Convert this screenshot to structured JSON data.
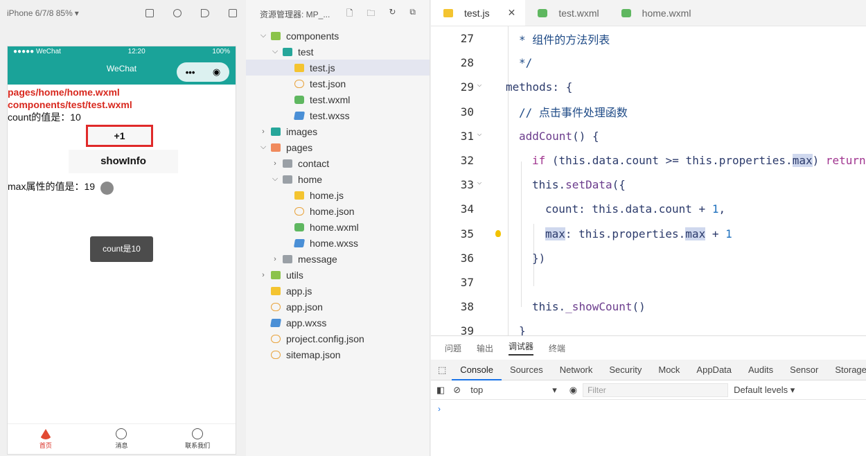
{
  "simulator": {
    "device": "iPhone 6/7/8 85%",
    "carrier": "●●●●● WeChat",
    "time": "12:20",
    "battery": "100%",
    "nav_title": "WeChat",
    "lines": {
      "home_path": "pages/home/home.wxml",
      "test_path": "components/test/test.wxml",
      "count_text": "count的值是：10",
      "add_button": "+1",
      "showinfo_button": "showInfo",
      "max_text": "max属性的值是：19"
    },
    "toast": "count是10",
    "tabbar": [
      {
        "label": "首页",
        "icon": "home-icon"
      },
      {
        "label": "消息",
        "icon": "chat-icon"
      },
      {
        "label": "联系我们",
        "icon": "phone-icon"
      }
    ]
  },
  "explorer": {
    "title": "资源管理器: MP_...",
    "tree": [
      {
        "label": "components",
        "depth": 0,
        "chev": "v",
        "icon": "fold-g"
      },
      {
        "label": "test",
        "depth": 1,
        "chev": "v",
        "icon": "fold-t"
      },
      {
        "label": "test.js",
        "depth": 2,
        "chev": "",
        "icon": "js",
        "selected": true
      },
      {
        "label": "test.json",
        "depth": 2,
        "chev": "",
        "icon": "json"
      },
      {
        "label": "test.wxml",
        "depth": 2,
        "chev": "",
        "icon": "wxml"
      },
      {
        "label": "test.wxss",
        "depth": 2,
        "chev": "",
        "icon": "wxss"
      },
      {
        "label": "images",
        "depth": 0,
        "chev": ">",
        "icon": "fold-t"
      },
      {
        "label": "pages",
        "depth": 0,
        "chev": "v",
        "icon": "fold-o"
      },
      {
        "label": "contact",
        "depth": 1,
        "chev": ">",
        "icon": "folder"
      },
      {
        "label": "home",
        "depth": 1,
        "chev": "v",
        "icon": "folder"
      },
      {
        "label": "home.js",
        "depth": 2,
        "chev": "",
        "icon": "js"
      },
      {
        "label": "home.json",
        "depth": 2,
        "chev": "",
        "icon": "json"
      },
      {
        "label": "home.wxml",
        "depth": 2,
        "chev": "",
        "icon": "wxml"
      },
      {
        "label": "home.wxss",
        "depth": 2,
        "chev": "",
        "icon": "wxss"
      },
      {
        "label": "message",
        "depth": 1,
        "chev": ">",
        "icon": "folder"
      },
      {
        "label": "utils",
        "depth": 0,
        "chev": ">",
        "icon": "fold-g"
      },
      {
        "label": "app.js",
        "depth": 0,
        "chev": "",
        "icon": "js"
      },
      {
        "label": "app.json",
        "depth": 0,
        "chev": "",
        "icon": "json"
      },
      {
        "label": "app.wxss",
        "depth": 0,
        "chev": "",
        "icon": "wxss"
      },
      {
        "label": "project.config.json",
        "depth": 0,
        "chev": "",
        "icon": "json"
      },
      {
        "label": "sitemap.json",
        "depth": 0,
        "chev": "",
        "icon": "json"
      }
    ]
  },
  "editor": {
    "tabs": [
      {
        "label": "test.js",
        "active": true
      },
      {
        "label": "test.wxml",
        "active": false
      },
      {
        "label": "home.wxml",
        "active": false
      }
    ],
    "lines": [
      {
        "n": "27",
        "fold": false,
        "segs": [
          [
            "cm",
            "* 组件的方法列表"
          ]
        ]
      },
      {
        "n": "28",
        "fold": false,
        "segs": [
          [
            "cm",
            "*/"
          ]
        ]
      },
      {
        "n": "29",
        "fold": true,
        "segs": [
          [
            "txt",
            "methods: {"
          ]
        ]
      },
      {
        "n": "30",
        "fold": false,
        "segs": [
          [
            "cm",
            "// 点击事件处理函数"
          ]
        ]
      },
      {
        "n": "31",
        "fold": true,
        "segs": [
          [
            "fn",
            "addCount"
          ],
          [
            "txt",
            "() {"
          ]
        ]
      },
      {
        "n": "32",
        "fold": false,
        "segs": [
          [
            "kw",
            "if"
          ],
          [
            "txt",
            " (this.data.count >= this.properties."
          ],
          [
            "hl",
            "max"
          ],
          [
            "txt",
            ") "
          ],
          [
            "kw",
            "return"
          ]
        ]
      },
      {
        "n": "33",
        "fold": true,
        "segs": [
          [
            "txt",
            "this."
          ],
          [
            "fn",
            "setData"
          ],
          [
            "txt",
            "({"
          ]
        ]
      },
      {
        "n": "34",
        "fold": false,
        "segs": [
          [
            "txt",
            "count: this.data.count + "
          ],
          [
            "num",
            "1"
          ],
          [
            "txt",
            ","
          ]
        ]
      },
      {
        "n": "35",
        "fold": false,
        "segs": [
          [
            "hl",
            "max"
          ],
          [
            "txt",
            ": this.properties."
          ],
          [
            "hl",
            "max"
          ],
          [
            "txt",
            " + "
          ],
          [
            "num",
            "1"
          ]
        ]
      },
      {
        "n": "36",
        "fold": false,
        "segs": [
          [
            "txt",
            "})"
          ]
        ]
      },
      {
        "n": "37",
        "fold": false,
        "segs": []
      },
      {
        "n": "38",
        "fold": false,
        "segs": [
          [
            "txt",
            "this."
          ],
          [
            "fn",
            "_showCount"
          ],
          [
            "txt",
            "()"
          ]
        ]
      },
      {
        "n": "39",
        "fold": false,
        "segs": [
          [
            "txt",
            "}"
          ]
        ]
      }
    ]
  },
  "panel": {
    "tabs": [
      "问题",
      "输出",
      "调试器",
      "终端"
    ],
    "active_tab": "调试器",
    "devtabs": [
      "Console",
      "Sources",
      "Network",
      "Security",
      "Mock",
      "AppData",
      "Audits",
      "Sensor",
      "Storage"
    ],
    "active_devtab": "Console",
    "context": "top",
    "filter_placeholder": "Filter",
    "levels": "Default levels ▾"
  }
}
